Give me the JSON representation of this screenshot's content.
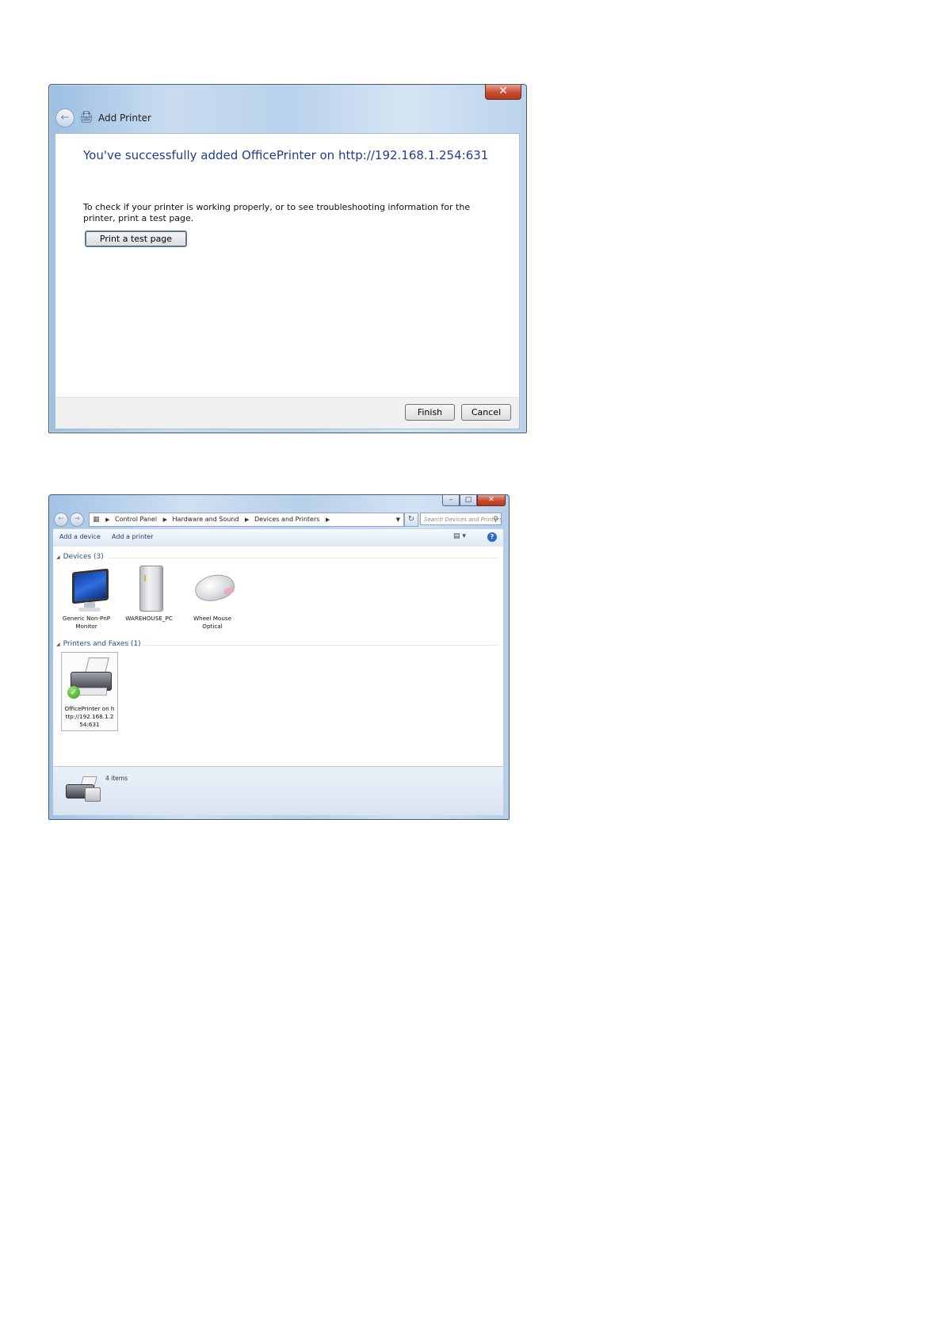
{
  "add_printer": {
    "close_label": "✕",
    "title": "Add Printer",
    "heading": "You've successfully added OfficePrinter on http://192.168.1.254:631",
    "description": "To check if your printer is working properly, or to see troubleshooting information for the printer, print a test page.",
    "test_button": "Print a test page",
    "finish_button": "Finish",
    "cancel_button": "Cancel"
  },
  "devices_window": {
    "controls": {
      "minimize": "–",
      "maximize": "□",
      "close": "✕"
    },
    "breadcrumb": [
      "Control Panel",
      "Hardware and Sound",
      "Devices and Printers"
    ],
    "search_placeholder": "Search Devices and Printers",
    "commands": {
      "add_device": "Add a device",
      "add_printer": "Add a printer"
    },
    "groups": {
      "devices": {
        "label": "Devices (3)",
        "items": [
          {
            "name": "Generic Non-PnP Monitor",
            "icon": "monitor-icon"
          },
          {
            "name": "WAREHOUSE_PC",
            "icon": "computer-icon"
          },
          {
            "name": "Wheel Mouse Optical",
            "icon": "mouse-icon"
          }
        ]
      },
      "printers": {
        "label": "Printers and Faxes (1)",
        "items": [
          {
            "name": "OfficePrinter on http://192.168.1.254:631",
            "icon": "printer-icon",
            "default": true
          }
        ]
      }
    },
    "status": {
      "count": "4 items"
    }
  }
}
